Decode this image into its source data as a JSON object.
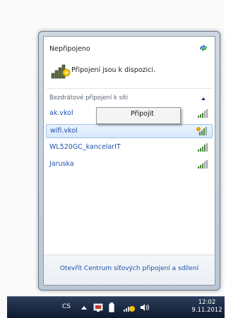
{
  "flyout": {
    "status_title": "Nepřipojeno",
    "status_desc": "Připojení jsou k dispozici.",
    "section_label": "Bezdrátové připojení k síti",
    "networks": [
      {
        "name": "ak.vkol",
        "signal": 4,
        "secured": false,
        "selected": false
      },
      {
        "name": "wifi.vkol",
        "signal": 4,
        "secured": true,
        "selected": true
      },
      {
        "name": "WL520GC_kancelarIT",
        "signal": 4,
        "secured": false,
        "selected": false
      },
      {
        "name": "Jaruska",
        "signal": 4,
        "secured": false,
        "selected": false
      }
    ],
    "context_menu": {
      "connect_label": "Připojit"
    },
    "open_center_link": "Otevřít Centrum síťových připojení a sdílení"
  },
  "taskbar": {
    "language": "CS",
    "clock_time": "12:02",
    "clock_date": "9.11.2012",
    "icons": [
      "show-hidden-icons-arrow",
      "action-center-icon",
      "battery-icon",
      "network-icon",
      "volume-icon"
    ]
  },
  "colors": {
    "link": "#1f4fa8",
    "selection_bg": "#d7e8fb",
    "taskbar": "#0e1a30"
  }
}
